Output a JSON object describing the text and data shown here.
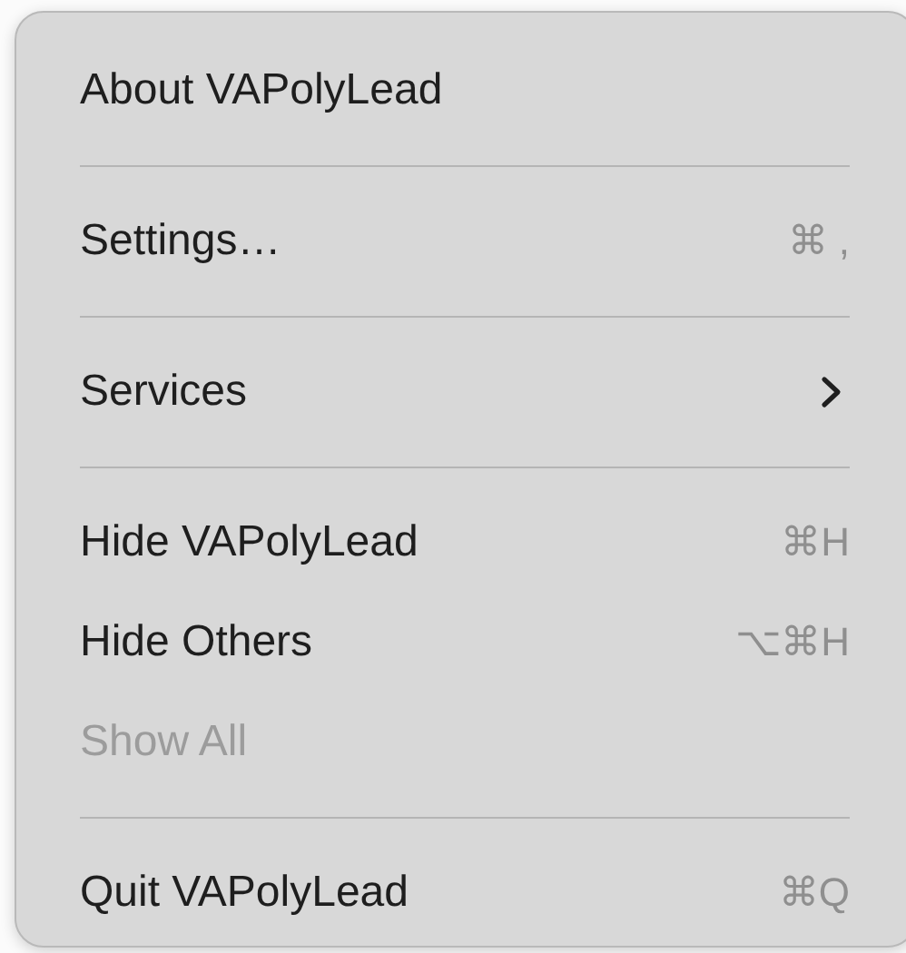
{
  "menu": {
    "items": [
      {
        "kind": "item",
        "label": "About VAPolyLead",
        "disabled": false
      },
      {
        "kind": "separator"
      },
      {
        "kind": "item",
        "label": "Settings…",
        "shortcut": "⌘ ,",
        "disabled": false
      },
      {
        "kind": "separator"
      },
      {
        "kind": "item",
        "label": "Services",
        "has_submenu": true,
        "disabled": false
      },
      {
        "kind": "separator"
      },
      {
        "kind": "item",
        "label": "Hide VAPolyLead",
        "shortcut": "⌘H",
        "disabled": false
      },
      {
        "kind": "item",
        "label": "Hide Others",
        "shortcut": "⌥⌘H",
        "disabled": false
      },
      {
        "kind": "item",
        "label": "Show All",
        "disabled": true
      },
      {
        "kind": "separator"
      },
      {
        "kind": "item",
        "label": "Quit VAPolyLead",
        "shortcut": "⌘Q",
        "disabled": false
      }
    ]
  }
}
